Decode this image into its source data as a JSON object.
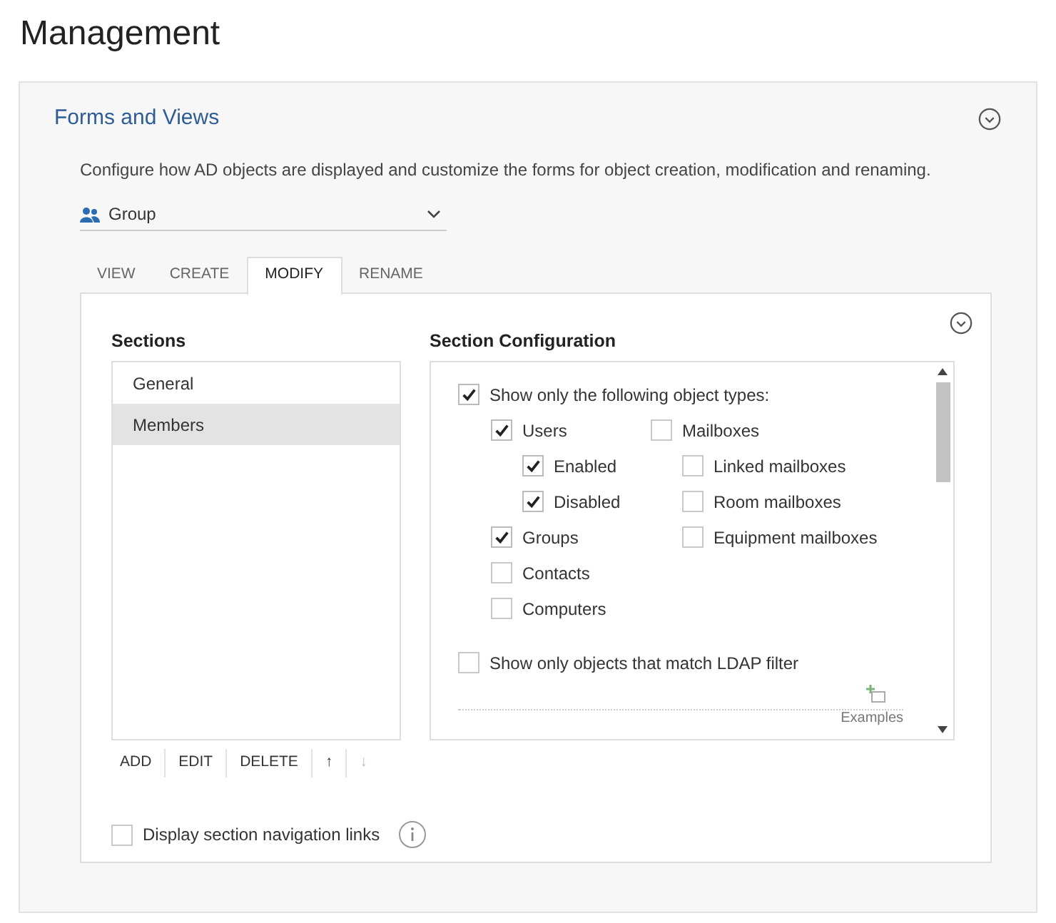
{
  "page_title": "Management",
  "card": {
    "title": "Forms and Views",
    "description": "Configure how AD objects are displayed and customize the forms for object creation, modification and renaming.",
    "object_type": {
      "value": "Group"
    },
    "tabs": [
      {
        "label": "VIEW",
        "selected": false
      },
      {
        "label": "CREATE",
        "selected": false
      },
      {
        "label": "MODIFY",
        "selected": true
      },
      {
        "label": "RENAME",
        "selected": false
      }
    ],
    "sections_panel": {
      "title": "Sections",
      "items": [
        {
          "label": "General",
          "selected": false
        },
        {
          "label": "Members",
          "selected": true
        }
      ],
      "toolbar": [
        {
          "label": "ADD",
          "disabled": false
        },
        {
          "label": "EDIT",
          "disabled": false
        },
        {
          "label": "DELETE",
          "disabled": false
        },
        {
          "label": "↑",
          "disabled": false
        },
        {
          "label": "↓",
          "disabled": true
        }
      ]
    },
    "navigation_links": {
      "label": "Display section navigation links",
      "checked": false
    },
    "section_configuration": {
      "title": "Section Configuration",
      "object_types": {
        "label": "Show only the following object types:",
        "checked": true
      },
      "columns": [
        [
          {
            "label": "Users",
            "checked": true,
            "children": [
              {
                "label": "Enabled",
                "checked": true
              },
              {
                "label": "Disabled",
                "checked": true
              }
            ]
          },
          {
            "label": "Groups",
            "checked": true
          },
          {
            "label": "Contacts",
            "checked": false
          },
          {
            "label": "Computers",
            "checked": false
          }
        ],
        [
          {
            "label": "Mailboxes",
            "checked": false,
            "children": [
              {
                "label": "Linked mailboxes",
                "checked": false
              },
              {
                "label": "Room mailboxes",
                "checked": false
              },
              {
                "label": "Equipment mailboxes",
                "checked": false
              }
            ]
          }
        ]
      ],
      "ldap_filter": {
        "label": "Show only objects that match LDAP filter",
        "checked": false
      },
      "examples_link": "Examples"
    }
  }
}
